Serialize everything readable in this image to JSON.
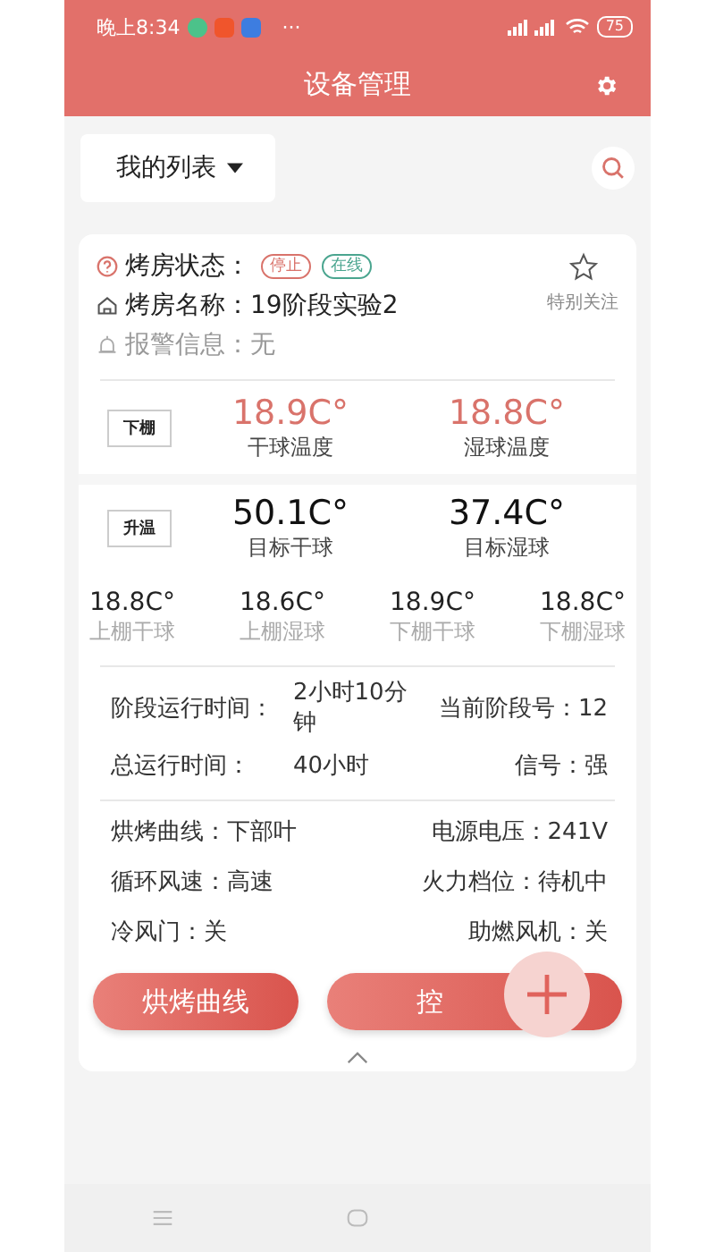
{
  "status_bar": {
    "time": "晚上8:34",
    "more": "···",
    "battery": "75"
  },
  "header": {
    "title": "设备管理"
  },
  "filter": {
    "label": "我的列表"
  },
  "card": {
    "status_label": "烤房状态：",
    "status_tags": [
      {
        "text": "停止",
        "color": "#d9736b"
      },
      {
        "text": "在线",
        "color": "#4aa58f"
      }
    ],
    "name_label": "烤房名称：19阶段实验2",
    "alarm_label": "报警信息：无",
    "favorite": {
      "label": "特别关注",
      "selected": false
    },
    "panels": [
      {
        "tag": "下棚",
        "highlight": true,
        "readings": [
          {
            "value": "18.9C°",
            "label": "干球温度"
          },
          {
            "value": "18.8C°",
            "label": "湿球温度"
          }
        ]
      },
      {
        "tag": "升温",
        "highlight": false,
        "readings": [
          {
            "value": "50.1C°",
            "label": "目标干球"
          },
          {
            "value": "37.4C°",
            "label": "目标湿球"
          }
        ]
      }
    ],
    "sensors": [
      {
        "value": "18.8C°",
        "label": "上棚干球"
      },
      {
        "value": "18.6C°",
        "label": "上棚湿球"
      },
      {
        "value": "18.9C°",
        "label": "下棚干球"
      },
      {
        "value": "18.8C°",
        "label": "下棚湿球"
      }
    ],
    "run_info": [
      {
        "label": "阶段运行时间：",
        "value": "2小时10分钟",
        "right": "当前阶段号：12"
      },
      {
        "label": "总运行时间：",
        "value": "40小时",
        "right": "信号：强"
      }
    ],
    "details": [
      {
        "left": "烘烤曲线：下部叶",
        "right": "电源电压：241V"
      },
      {
        "left": "循环风速：高速",
        "right": "火力档位：待机中"
      },
      {
        "left": "冷风门：关",
        "right": "助燃风机：关"
      }
    ],
    "buttons": [
      "烘烤曲线",
      "控"
    ]
  }
}
